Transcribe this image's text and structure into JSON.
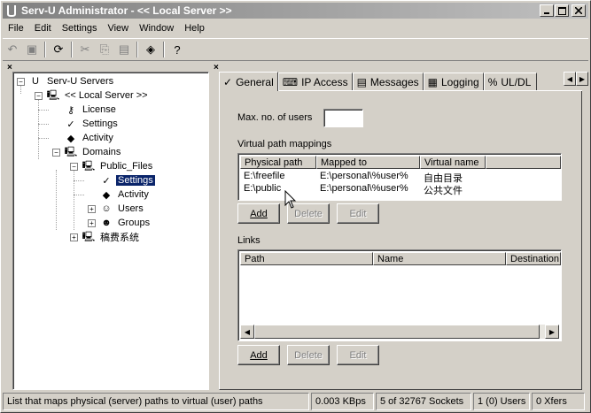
{
  "window": {
    "title": "Serv-U Administrator - << Local Server >>"
  },
  "menu": [
    "File",
    "Edit",
    "Settings",
    "View",
    "Window",
    "Help"
  ],
  "toolbar": {
    "icons": [
      "undo-icon",
      "save-icon",
      "refresh-icon",
      "cut-icon",
      "copy-icon",
      "paste-icon",
      "help-book-icon",
      "help-icon"
    ]
  },
  "tree": {
    "servers": "Serv-U Servers",
    "local_server": "<< Local Server >>",
    "license": "License",
    "settings": "Settings",
    "activity": "Activity",
    "domains": "Domains",
    "public_files": "Public_Files",
    "pf_settings": "Settings",
    "pf_activity": "Activity",
    "users": "Users",
    "groups": "Groups",
    "cn_domain": "稿费系统"
  },
  "tabs": [
    "General",
    "IP Access",
    "Messages",
    "Logging",
    "UL/DL"
  ],
  "general": {
    "max_users_label": "Max. no. of users",
    "max_users_value": "",
    "vpath_label": "Virtual path mappings",
    "vpath_columns": [
      "Physical path",
      "Mapped to",
      "Virtual name"
    ],
    "vpath_rows": [
      [
        "E:\\freefile",
        "E:\\personal\\%user%",
        "自由目录"
      ],
      [
        "E:\\public",
        "E:\\personal\\%user%",
        "公共文件"
      ]
    ],
    "add": "Add",
    "delete": "Delete",
    "edit": "Edit",
    "links_label": "Links",
    "links_columns": [
      "Path",
      "Name",
      "Destination"
    ]
  },
  "status": {
    "message": "List that maps physical (server) paths to virtual (user) paths",
    "speed": "0.003 KBps",
    "sockets": "5 of 32767 Sockets",
    "users": "1 (0) Users",
    "xfers": "0 Xfers"
  }
}
